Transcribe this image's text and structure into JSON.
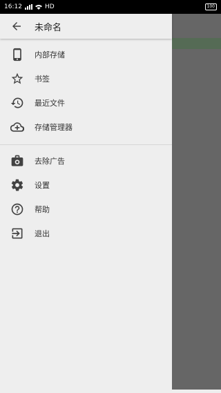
{
  "status_bar": {
    "time": "16:12",
    "network": "HD",
    "battery": "100"
  },
  "header": {
    "title": "未命名",
    "back_icon": "arrow-back-icon"
  },
  "menu": {
    "group1": [
      {
        "label": "内部存储",
        "icon": "phone-icon"
      },
      {
        "label": "书签",
        "icon": "star-icon"
      },
      {
        "label": "最近文件",
        "icon": "history-icon"
      },
      {
        "label": "存储管理器",
        "icon": "cloud-add-icon"
      }
    ],
    "group2": [
      {
        "label": "去除广告",
        "icon": "camera-bag-icon"
      },
      {
        "label": "设置",
        "icon": "gear-icon"
      },
      {
        "label": "帮助",
        "icon": "help-icon"
      },
      {
        "label": "退出",
        "icon": "exit-icon"
      }
    ]
  },
  "colors": {
    "drawer_bg": "#eeeeee",
    "scrim": "#666666",
    "icon": "#424242",
    "text": "#333333"
  }
}
